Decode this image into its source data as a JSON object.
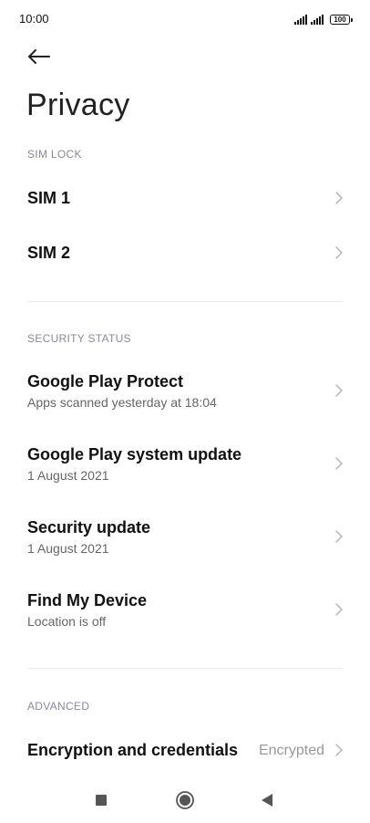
{
  "status_bar": {
    "time": "10:00",
    "battery_level": "100",
    "icons": [
      "signal-icon",
      "signal-icon",
      "battery-icon"
    ]
  },
  "header": {
    "back_icon": "back-arrow-icon",
    "title": "Privacy"
  },
  "sections": {
    "sim_lock": {
      "header": "SIM LOCK",
      "items": [
        {
          "title": "SIM 1"
        },
        {
          "title": "SIM 2"
        }
      ]
    },
    "security_status": {
      "header": "SECURITY STATUS",
      "items": [
        {
          "title": "Google Play Protect",
          "subtitle": "Apps scanned yesterday at 18:04"
        },
        {
          "title": "Google Play system update",
          "subtitle": "1 August 2021"
        },
        {
          "title": "Security update",
          "subtitle": "1 August 2021"
        },
        {
          "title": "Find My Device",
          "subtitle": "Location is off"
        }
      ]
    },
    "advanced": {
      "header": "ADVANCED",
      "items": [
        {
          "title": "Encryption and credentials",
          "value": "Encrypted"
        }
      ]
    }
  },
  "navigation_bar": {
    "icons": [
      "recents-square-icon",
      "home-circle-icon",
      "back-triangle-icon"
    ]
  },
  "colors": {
    "text_primary": "#111111",
    "text_secondary": "#666666",
    "section_header": "#8a8a9a",
    "chevron": "#b0b0b0",
    "divider": "#ececec",
    "value_text": "#999999"
  }
}
